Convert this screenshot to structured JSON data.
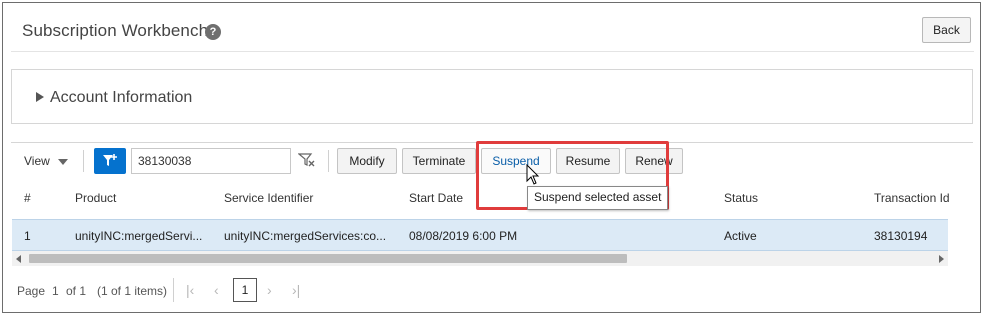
{
  "header": {
    "title": "Subscription Workbench:",
    "help_icon": "?",
    "back_label": "Back"
  },
  "account_section": {
    "label": "Account Information",
    "expanded": false
  },
  "toolbar": {
    "view_label": "View",
    "search_value": "38130038",
    "buttons": [
      "Modify",
      "Terminate",
      "Suspend",
      "Resume",
      "Renew"
    ],
    "active_button": "Suspend",
    "accent_color": "#0572ce",
    "highlight_color": "#e03c3c"
  },
  "tooltip": "Suspend selected asset",
  "table": {
    "columns": [
      "#",
      "Product",
      "Service Identifier",
      "Start Date",
      "Status",
      "Transaction Id"
    ],
    "rows": [
      [
        "1",
        "unityINC:mergedServi...",
        "unityINC:mergedServices:co...",
        "08/08/2019 6:00 PM",
        "Active",
        "38130194"
      ]
    ]
  },
  "pagination": {
    "page_label": "Page",
    "page": "1",
    "of_label": "of 1",
    "items_label": "(1 of 1 items)",
    "current": "1"
  }
}
